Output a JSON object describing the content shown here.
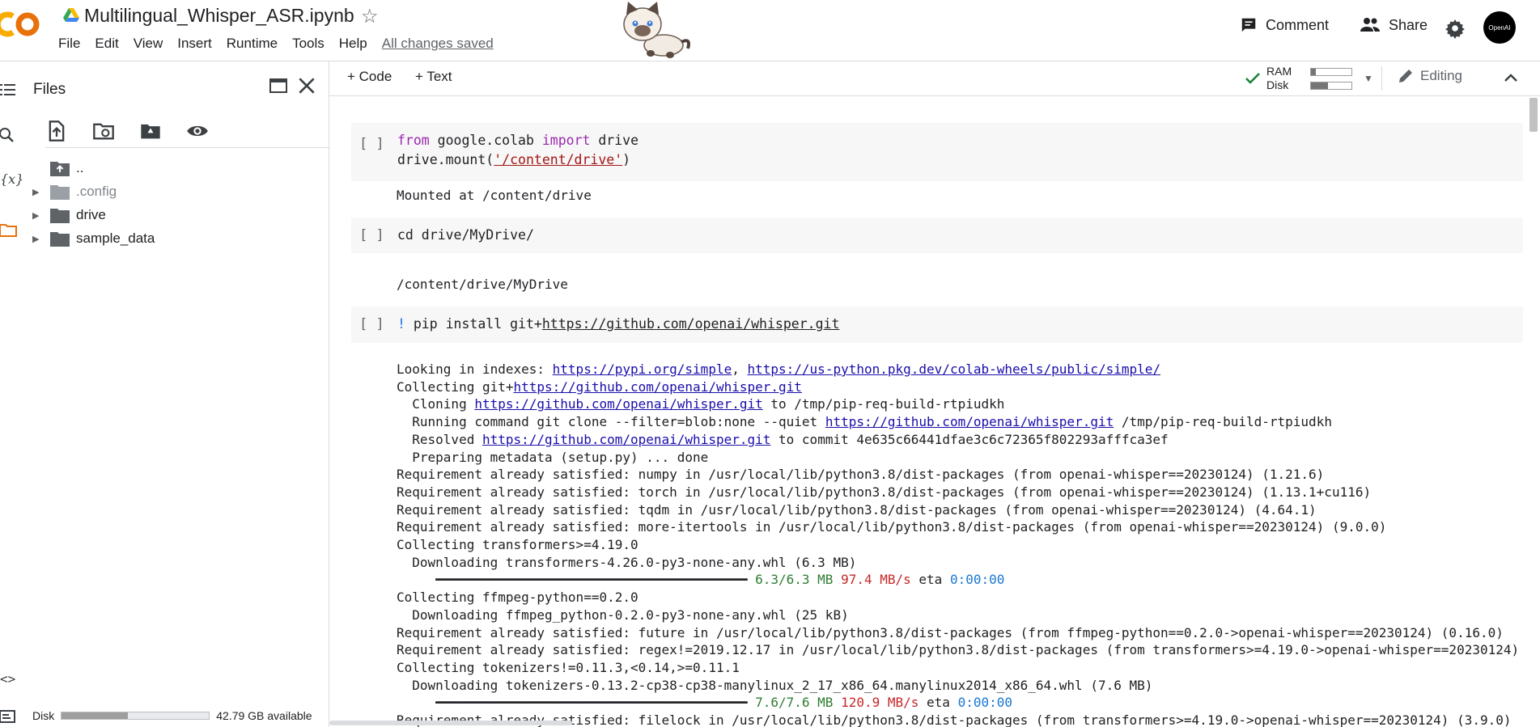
{
  "app": {
    "notebook_title": "Multilingual_Whisper_ASR.ipynb",
    "menu": [
      "File",
      "Edit",
      "View",
      "Insert",
      "Runtime",
      "Tools",
      "Help"
    ],
    "save_status": "All changes saved",
    "comment_label": "Comment",
    "share_label": "Share",
    "avatar_text": "OpenAI"
  },
  "files_panel": {
    "title": "Files",
    "tree": [
      {
        "name": "..",
        "type": "parent"
      },
      {
        "name": ".config",
        "type": "folder-muted"
      },
      {
        "name": "drive",
        "type": "folder"
      },
      {
        "name": "sample_data",
        "type": "folder"
      }
    ],
    "disk_label": "Disk",
    "disk_available": "42.79 GB available",
    "disk_used_fraction": 0.45
  },
  "toolbar": {
    "code_label": "+ Code",
    "text_label": "+ Text",
    "ram_label": "RAM",
    "disk_label": "Disk",
    "ram_fraction": 0.12,
    "disk_fraction": 0.42,
    "editing_label": "Editing"
  },
  "cells": [
    {
      "run": "[ ]",
      "code_plain": "from google.colab import drive",
      "code2": "drive.mount(",
      "code2_str": "'/content/drive'",
      "code2_end": ")",
      "output": "Mounted at /content/drive"
    },
    {
      "run": "[ ]",
      "code": "cd drive/MyDrive/",
      "output": "/content/drive/MyDrive"
    },
    {
      "run": "[ ]",
      "bang": "!",
      "code": " pip install git+",
      "link": "https://github.com/openai/whisper.git"
    }
  ],
  "pip_output": {
    "l1a": "Looking in indexes: ",
    "l1b": "https://pypi.org/simple",
    "l1c": ", ",
    "l1d": "https://us-python.pkg.dev/colab-wheels/public/simple/",
    "l2a": "Collecting git+",
    "l2b": "https://github.com/openai/whisper.git",
    "l3a": "  Cloning ",
    "l3b": "https://github.com/openai/whisper.git",
    "l3c": " to /tmp/pip-req-build-rtpiudkh",
    "l4a": "  Running command git clone --filter=blob:none --quiet ",
    "l4b": "https://github.com/openai/whisper.git",
    "l4c": " /tmp/pip-req-build-rtpiudkh",
    "l5a": "  Resolved ",
    "l5b": "https://github.com/openai/whisper.git",
    "l5c": " to commit 4e635c66441dfae3c6c72365f802293afffca3ef",
    "l6": "  Preparing metadata (setup.py) ... done",
    "l7": "Requirement already satisfied: numpy in /usr/local/lib/python3.8/dist-packages (from openai-whisper==20230124) (1.21.6)",
    "l8": "Requirement already satisfied: torch in /usr/local/lib/python3.8/dist-packages (from openai-whisper==20230124) (1.13.1+cu116)",
    "l9": "Requirement already satisfied: tqdm in /usr/local/lib/python3.8/dist-packages (from openai-whisper==20230124) (4.64.1)",
    "l10": "Requirement already satisfied: more-itertools in /usr/local/lib/python3.8/dist-packages (from openai-whisper==20230124) (9.0.0)",
    "l11": "Collecting transformers>=4.19.0",
    "l12": "  Downloading transformers-4.26.0-py3-none-any.whl (6.3 MB)",
    "l13a": "     ━━━━━━━━━━━━━━━━━━━━━━━━━━━━━━━━━━━━━━━━ ",
    "l13b": "6.3/6.3 MB",
    "l13c": " ",
    "l13d": "97.4 MB/s",
    "l13e": " eta ",
    "l13f": "0:00:00",
    "l14": "Collecting ffmpeg-python==0.2.0",
    "l15": "  Downloading ffmpeg_python-0.2.0-py3-none-any.whl (25 kB)",
    "l16": "Requirement already satisfied: future in /usr/local/lib/python3.8/dist-packages (from ffmpeg-python==0.2.0->openai-whisper==20230124) (0.16.0)",
    "l17": "Requirement already satisfied: regex!=2019.12.17 in /usr/local/lib/python3.8/dist-packages (from transformers>=4.19.0->openai-whisper==20230124)",
    "l18": "Collecting tokenizers!=0.11.3,<0.14,>=0.11.1",
    "l19": "  Downloading tokenizers-0.13.2-cp38-cp38-manylinux_2_17_x86_64.manylinux2014_x86_64.whl (7.6 MB)",
    "l20a": "     ━━━━━━━━━━━━━━━━━━━━━━━━━━━━━━━━━━━━━━━━ ",
    "l20b": "7.6/7.6 MB",
    "l20c": " ",
    "l20d": "120.9 MB/s",
    "l20e": " eta ",
    "l20f": "0:00:00",
    "l21": "Requirement already satisfied: filelock in /usr/local/lib/python3.8/dist-packages (from transformers>=4.19.0->openai-whisper==20230124) (3.9.0)"
  }
}
